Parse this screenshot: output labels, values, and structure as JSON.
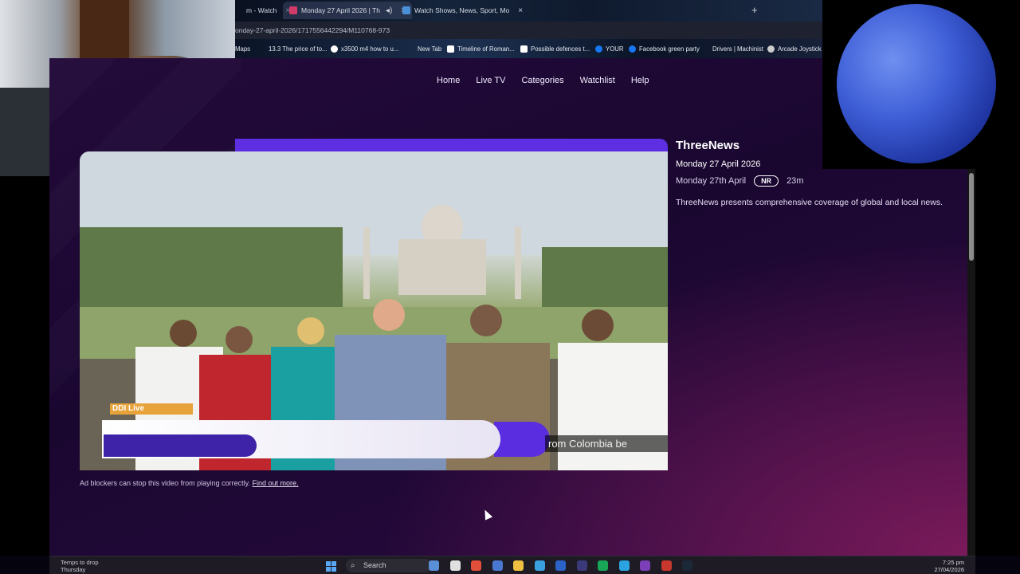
{
  "browser": {
    "tabs": [
      {
        "label": "m - Watch",
        "favicon_color": "#444"
      },
      {
        "label": "Monday 27 April 2026 | Th",
        "favicon_color": "#d23a6a"
      },
      {
        "label": "Watch Shows, News, Sport, Mo",
        "favicon_color": "#4a90d9"
      }
    ],
    "new_tab": "+",
    "url": "onday-27-april-2026/1717556442294/M110768-973",
    "bookmarks": [
      {
        "label": "Maps",
        "color": "#4caf50"
      },
      {
        "label": "13.3 The price of to...",
        "color": "#888"
      },
      {
        "label": "x3500 m4 how to u...",
        "color": "#ffffff"
      },
      {
        "label": "New Tab",
        "color": "#888"
      },
      {
        "label": "Timeline of Roman...",
        "color": "#ffffff"
      },
      {
        "label": "Possible defences t...",
        "color": "#444"
      },
      {
        "label": "YOUR",
        "color": "#1877f2"
      },
      {
        "label": "Facebook green party",
        "color": "#1877f2"
      },
      {
        "label": "Drivers | Machinist",
        "color": "#444"
      },
      {
        "label": "Arcade Joystick w",
        "color": "#ccc"
      }
    ]
  },
  "nav": {
    "items": [
      "Home",
      "Live TV",
      "Categories",
      "Watchlist",
      "Help"
    ]
  },
  "video": {
    "channel_bug": "DDI Live",
    "ticker": "rom Colombia be",
    "ad_note": "Ad blockers can stop this video from playing correctly.",
    "ad_link": "Find out more."
  },
  "info": {
    "channel": "ThreeNews",
    "episode": "Monday 27 April 2026",
    "date": "Monday 27th April",
    "rating": "NR",
    "duration": "23m",
    "description": "ThreeNews presents comprehensive coverage of global and local news."
  },
  "taskbar": {
    "weather_title": "Temps to drop",
    "weather_sub": "Thursday",
    "search": "Search",
    "time": "7:25 pm",
    "date": "27/04/2026",
    "icons": [
      "#5a8fd8",
      "#e0e0e0",
      "#e24f3b",
      "#4a78d0",
      "#f0c040",
      "#3aa0e0",
      "#2b63c8",
      "#3a3a7a",
      "#18a558",
      "#2aa3e0",
      "#7b3fb8",
      "#c8372d",
      "#1b2838"
    ]
  },
  "colors": {
    "accent": "#5d2ee2",
    "page_bg": "#1a0730"
  }
}
